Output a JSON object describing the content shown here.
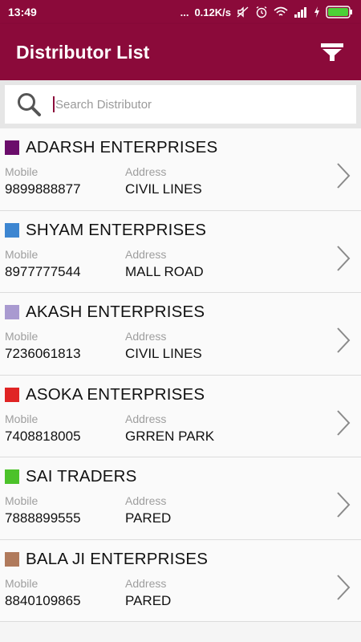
{
  "status_bar": {
    "time": "13:49",
    "dots": "...",
    "speed": "0.12K/s"
  },
  "app_bar": {
    "title": "Distributor List",
    "filter_icon": "filter-icon"
  },
  "search": {
    "placeholder": "Search Distributor",
    "value": "",
    "icon": "search-icon"
  },
  "labels": {
    "mobile": "Mobile",
    "address": "Address"
  },
  "distributors": [
    {
      "name": "ADARSH ENTERPRISES",
      "color": "#6b0d6b",
      "mobile_label": "Mobile",
      "mobile": "9899888877",
      "address_label": "Address",
      "address": "CIVIL LINES"
    },
    {
      "name": "SHYAM ENTERPRISES",
      "color": "#3d86d1",
      "mobile_label": "Mobile",
      "mobile": "8977777544",
      "address_label": "Address",
      "address": "MALL ROAD"
    },
    {
      "name": "AKASH ENTERPRISES",
      "color": "#a99ad0",
      "mobile_label": "Mobile",
      "mobile": "7236061813",
      "address_label": "Address",
      "address": "CIVIL LINES"
    },
    {
      "name": "ASOKA ENTERPRISES",
      "color": "#e02424",
      "mobile_label": "Mobile",
      "mobile": "7408818005",
      "address_label": "Address",
      "address": "GRREN PARK"
    },
    {
      "name": "SAI TRADERS",
      "color": "#4cc22a",
      "mobile_label": "Mobile",
      "mobile": "7888899555",
      "address_label": "Address",
      "address": "PARED"
    },
    {
      "name": "BALA JI ENTERPRISES",
      "color": "#b07a5c",
      "mobile_label": "Mobile",
      "mobile": "8840109865",
      "address_label": "Address",
      "address": "PARED"
    }
  ]
}
